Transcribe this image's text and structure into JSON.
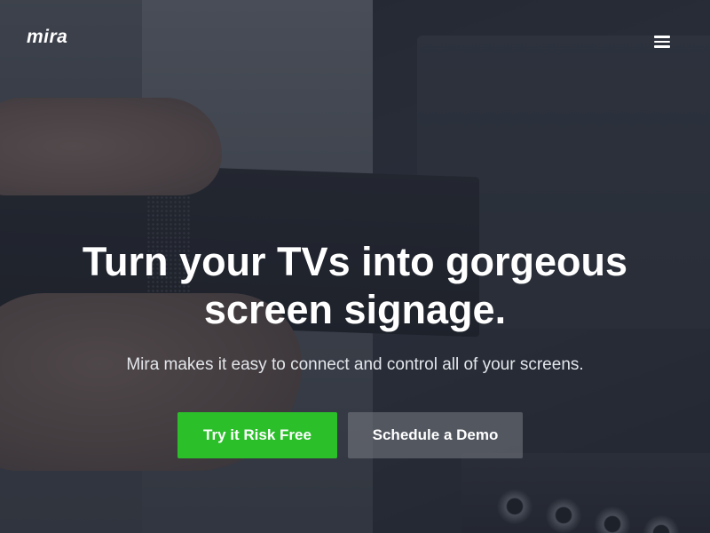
{
  "header": {
    "logo_text": "mira",
    "menu_icon": "hamburger-menu-icon"
  },
  "hero": {
    "headline": "Turn your TVs into gorgeous screen signage.",
    "subtext": "Mira makes it easy to connect and control all of your screens.",
    "primary_button_label": "Try it Risk Free",
    "secondary_button_label": "Schedule a Demo"
  },
  "colors": {
    "primary_button": "#2bbf2a",
    "overlay": "#1e2430",
    "text": "#ffffff"
  }
}
